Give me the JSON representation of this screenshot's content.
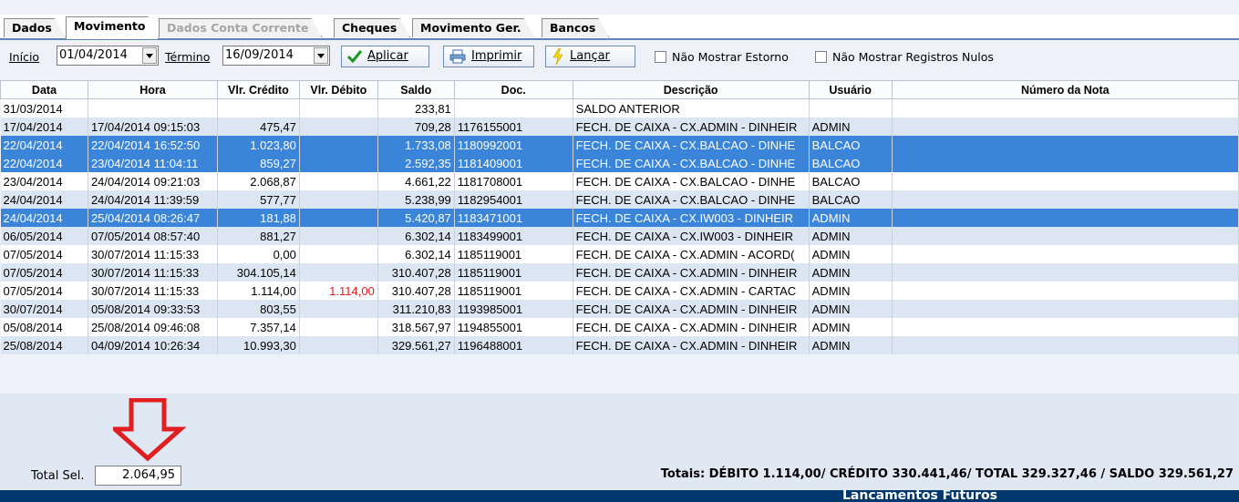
{
  "tabs": [
    {
      "label": "Dados",
      "state": "normal"
    },
    {
      "label": "Movimento",
      "state": "active"
    },
    {
      "label": "Dados Conta Corrente",
      "state": "disabled"
    },
    {
      "label": "Cheques",
      "state": "normal"
    },
    {
      "label": "Movimento Ger.",
      "state": "normal"
    },
    {
      "label": "Bancos",
      "state": "normal"
    }
  ],
  "toolbar": {
    "inicio_label": "Início",
    "inicio_value": "01/04/2014",
    "termino_label": "Término",
    "termino_value": "16/09/2014",
    "aplicar": "Aplicar",
    "imprimir": "Imprimir",
    "lancar": "Lançar",
    "nao_mostrar_estorno": "Não Mostrar Estorno",
    "nao_mostrar_nulos": "Não Mostrar Registros Nulos"
  },
  "table": {
    "columns": [
      "Data",
      "Hora",
      "Vlr. Crédito",
      "Vlr. Débito",
      "Saldo",
      "Doc.",
      "Descrição",
      "Usuário",
      "Número da Nota"
    ],
    "rows": [
      {
        "data": "31/03/2014",
        "hora": "",
        "credito": "",
        "debito": "",
        "saldo": "233,81",
        "doc": "",
        "descricao": "SALDO ANTERIOR",
        "usuario": "",
        "nota": "",
        "style": "white"
      },
      {
        "data": "17/04/2014",
        "hora": "17/04/2014 09:15:03",
        "credito": "475,47",
        "debito": "",
        "saldo": "709,28",
        "doc": "1176155001",
        "descricao": "FECH. DE CAIXA - CX.ADMIN - DINHEIR",
        "usuario": "ADMIN",
        "nota": "",
        "style": "alt"
      },
      {
        "data": "22/04/2014",
        "hora": "22/04/2014 16:52:50",
        "credito": "1.023,80",
        "debito": "",
        "saldo": "1.733,08",
        "doc": "1180992001",
        "descricao": "FECH. DE CAIXA - CX.BALCAO - DINHE",
        "usuario": "BALCAO",
        "nota": "",
        "style": "sel"
      },
      {
        "data": "22/04/2014",
        "hora": "23/04/2014 11:04:11",
        "credito": "859,27",
        "debito": "",
        "saldo": "2.592,35",
        "doc": "1181409001",
        "descricao": "FECH. DE CAIXA - CX.BALCAO - DINHE",
        "usuario": "BALCAO",
        "nota": "",
        "style": "sel"
      },
      {
        "data": "23/04/2014",
        "hora": "24/04/2014 09:21:03",
        "credito": "2.068,87",
        "debito": "",
        "saldo": "4.661,22",
        "doc": "1181708001",
        "descricao": "FECH. DE CAIXA - CX.BALCAO - DINHE",
        "usuario": "BALCAO",
        "nota": "",
        "style": "white"
      },
      {
        "data": "24/04/2014",
        "hora": "24/04/2014 11:39:59",
        "credito": "577,77",
        "debito": "",
        "saldo": "5.238,99",
        "doc": "1182954001",
        "descricao": "FECH. DE CAIXA - CX.BALCAO - DINHE",
        "usuario": "BALCAO",
        "nota": "",
        "style": "alt"
      },
      {
        "data": "24/04/2014",
        "hora": "25/04/2014 08:26:47",
        "credito": "181,88",
        "debito": "",
        "saldo": "5.420,87",
        "doc": "1183471001",
        "descricao": "FECH. DE CAIXA - CX.IW003 - DINHEIR",
        "usuario": "ADMIN",
        "nota": "",
        "style": "sel"
      },
      {
        "data": "06/05/2014",
        "hora": "07/05/2014 08:57:40",
        "credito": "881,27",
        "debito": "",
        "saldo": "6.302,14",
        "doc": "1183499001",
        "descricao": "FECH. DE CAIXA - CX.IW003 - DINHEIR",
        "usuario": "ADMIN",
        "nota": "",
        "style": "alt"
      },
      {
        "data": "07/05/2014",
        "hora": "30/07/2014 11:15:33",
        "credito": "0,00",
        "debito": "",
        "saldo": "6.302,14",
        "doc": "1185119001",
        "descricao": "FECH. DE CAIXA - CX.ADMIN - ACORD(",
        "usuario": "ADMIN",
        "nota": "",
        "style": "white"
      },
      {
        "data": "07/05/2014",
        "hora": "30/07/2014 11:15:33",
        "credito": "304.105,14",
        "debito": "",
        "saldo": "310.407,28",
        "doc": "1185119001",
        "descricao": "FECH. DE CAIXA - CX.ADMIN - DINHEIR",
        "usuario": "ADMIN",
        "nota": "",
        "style": "alt"
      },
      {
        "data": "07/05/2014",
        "hora": "30/07/2014 11:15:33",
        "credito": "1.114,00",
        "debito": "1.114,00",
        "saldo": "310.407,28",
        "doc": "1185119001",
        "descricao": "FECH. DE CAIXA - CX.ADMIN - CARTAC",
        "usuario": "ADMIN",
        "nota": "",
        "style": "white"
      },
      {
        "data": "30/07/2014",
        "hora": "05/08/2014 09:33:53",
        "credito": "803,55",
        "debito": "",
        "saldo": "311.210,83",
        "doc": "1193985001",
        "descricao": "FECH. DE CAIXA - CX.ADMIN - DINHEIR",
        "usuario": "ADMIN",
        "nota": "",
        "style": "alt"
      },
      {
        "data": "05/08/2014",
        "hora": "25/08/2014 09:46:08",
        "credito": "7.357,14",
        "debito": "",
        "saldo": "318.567,97",
        "doc": "1194855001",
        "descricao": "FECH. DE CAIXA - CX.ADMIN - DINHEIR",
        "usuario": "ADMIN",
        "nota": "",
        "style": "white"
      },
      {
        "data": "25/08/2014",
        "hora": "04/09/2014 10:26:34",
        "credito": "10.993,30",
        "debito": "",
        "saldo": "329.561,27",
        "doc": "1196488001",
        "descricao": "FECH. DE CAIXA - CX.ADMIN - DINHEIR",
        "usuario": "ADMIN",
        "nota": "",
        "style": "alt"
      }
    ]
  },
  "footer": {
    "total_sel_label": "Total Sel.",
    "total_sel_value": "2.064,95",
    "totais": "Totais: DÉBITO 1.114,00/ CRÉDITO  330.441,46/ TOTAL  329.327,46 / SALDO 329.561,27",
    "bottom_bar": "Lancamentos Futuros"
  },
  "colors": {
    "selected_row": "#3a85d9",
    "alt_row": "#dce6f2",
    "debit_text": "#e11b1b",
    "bottom_bar": "#00386e",
    "arrow": "#e02020"
  },
  "icons": {
    "aplicar": "checkmark-icon",
    "imprimir": "printer-icon",
    "lancar": "lightning-icon",
    "annotation": "down-arrow-icon"
  }
}
